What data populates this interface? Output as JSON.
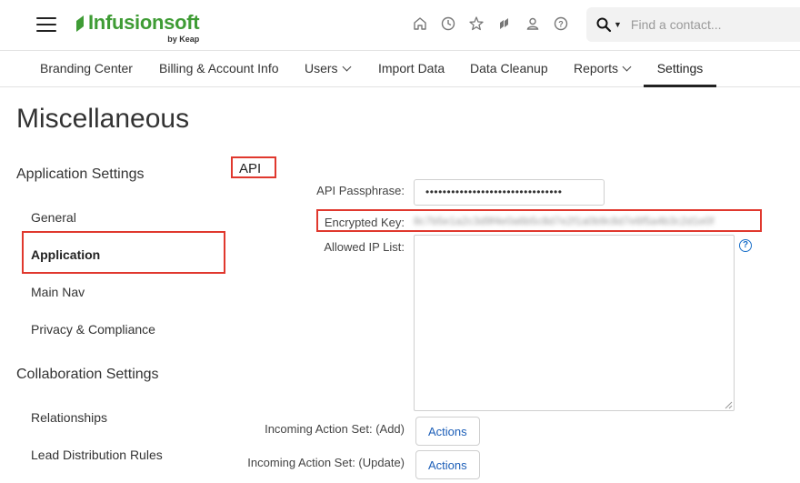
{
  "header": {
    "logo_text": "Infusionsoft",
    "logo_sub": "by Keap",
    "icons": [
      "home-icon",
      "clock-icon",
      "star-icon",
      "keap-icon",
      "user-icon",
      "help-icon"
    ],
    "search": {
      "placeholder": "Find a contact..."
    }
  },
  "nav": {
    "tabs": [
      {
        "label": "Branding Center"
      },
      {
        "label": "Billing & Account Info"
      },
      {
        "label": "Users"
      },
      {
        "label": "Import Data"
      },
      {
        "label": "Data Cleanup"
      },
      {
        "label": "Reports"
      },
      {
        "label": "Settings"
      }
    ],
    "active": "Settings"
  },
  "page": {
    "title": "Miscellaneous"
  },
  "sidebar": {
    "section1": "Application Settings",
    "section1_items": [
      {
        "label": "General"
      },
      {
        "label": "Application"
      },
      {
        "label": "Main Nav"
      },
      {
        "label": "Privacy & Compliance"
      }
    ],
    "section2": "Collaboration Settings",
    "section2_items": [
      {
        "label": "Relationships"
      },
      {
        "label": "Lead Distribution Rules"
      }
    ]
  },
  "api": {
    "heading": "API",
    "passphrase_label": "API Passphrase:",
    "passphrase_value": "••••••••••••••••••••••••••••••••",
    "encrypted_label": "Encrypted Key:",
    "encrypted_value": "8c7b5e1a2c3d9f4e0a6b5c8d7e2f1a0b9c8d7e6f5a4b3c2d1e0f",
    "ip_label": "Allowed IP List:",
    "ip_value": "",
    "help_icon_text": "?",
    "incoming_add_label": "Incoming Action Set: (Add)",
    "incoming_update_label": "Incoming Action Set: (Update)",
    "actions_button": "Actions"
  },
  "colors": {
    "brand_green": "#3f9c35",
    "highlight_red": "#e0382e",
    "link_blue": "#1d5fb8"
  }
}
